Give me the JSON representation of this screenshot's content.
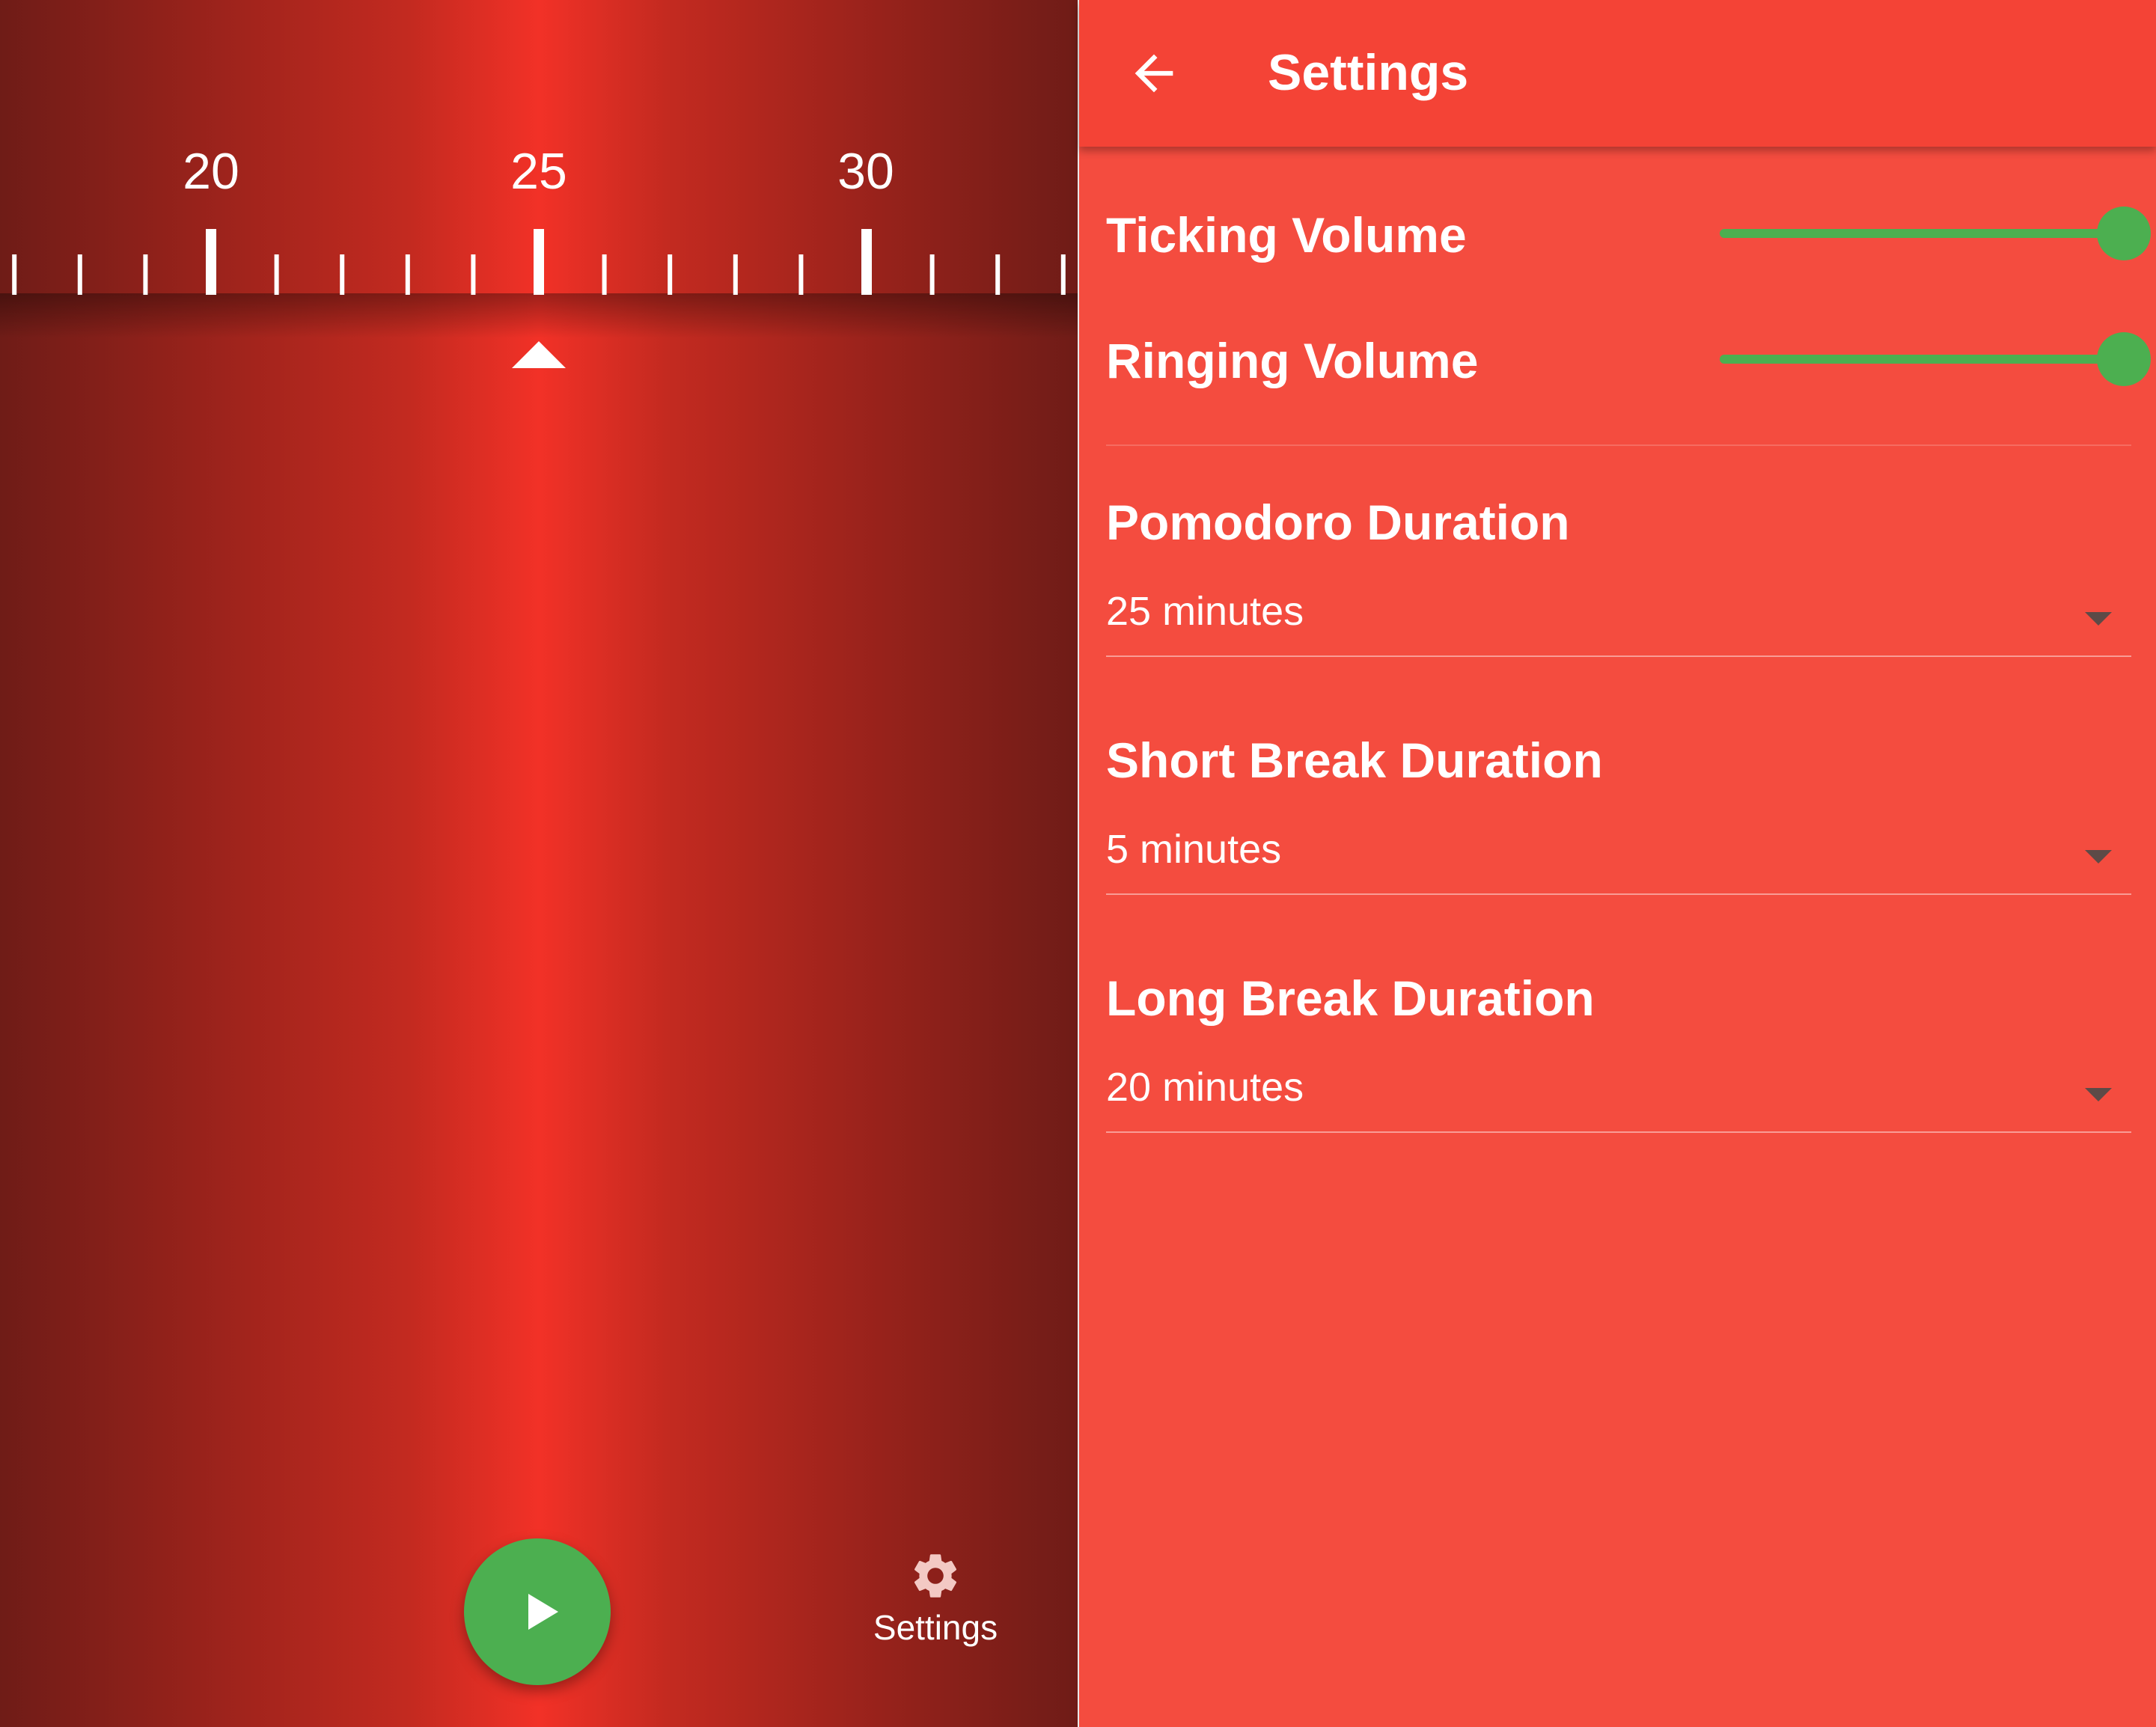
{
  "timer": {
    "ruler_labels": [
      "20",
      "25",
      "30"
    ],
    "selected_minutes": 25,
    "play_button_icon": "play-icon",
    "settings_shortcut": {
      "icon": "gear-icon",
      "label": "Settings"
    }
  },
  "settings": {
    "title": "Settings",
    "back_icon": "arrow-back-icon",
    "ticking_volume": {
      "label": "Ticking Volume",
      "value": 1.0
    },
    "ringing_volume": {
      "label": "Ringing Volume",
      "value": 1.0
    },
    "pomodoro": {
      "label": "Pomodoro Duration",
      "value": "25 minutes"
    },
    "short_break": {
      "label": "Short Break Duration",
      "value": "5 minutes"
    },
    "long_break": {
      "label": "Long Break Duration",
      "value": "20 minutes"
    }
  },
  "colors": {
    "accent": "#4caf50",
    "primary": "#f44336",
    "panel_background": "#f44c3f"
  }
}
